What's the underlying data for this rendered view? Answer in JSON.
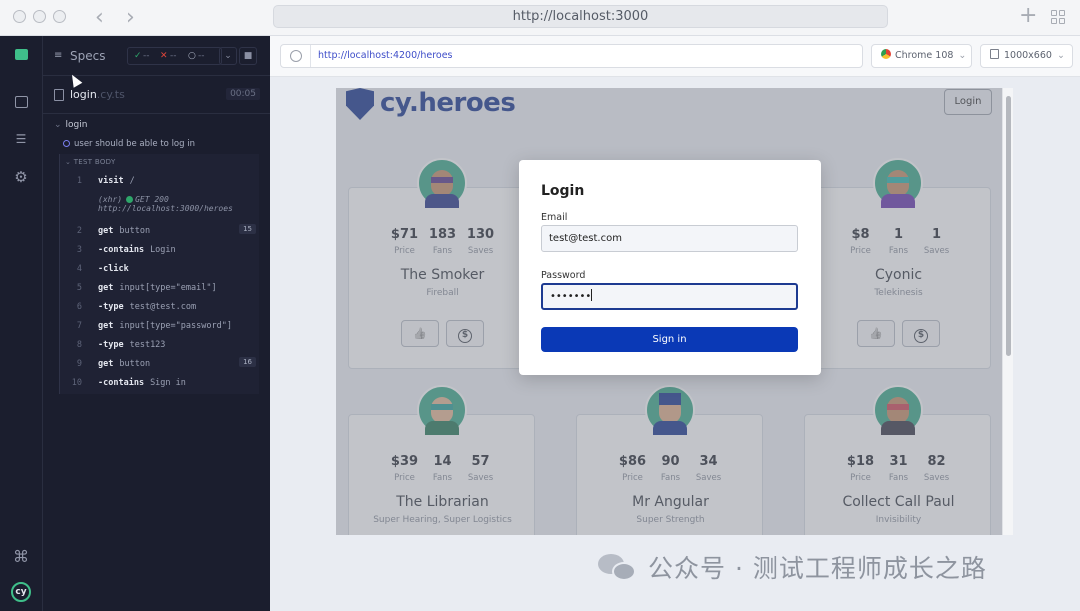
{
  "window": {
    "url": "http://localhost:3000"
  },
  "icons": {
    "back": "‹",
    "forward": "›",
    "plus": "+",
    "check": "✓",
    "cross": "✕",
    "pending": "○",
    "chevron": "⌄",
    "stop": "■",
    "rail_debug": "⌘",
    "like": "👍",
    "dollar": "$"
  },
  "reporter": {
    "specs_label": "Specs",
    "passed": "--",
    "failed": "--",
    "pending": "--",
    "file_name": "login",
    "file_ext": ".cy.ts",
    "duration": "00:05",
    "suite": "login",
    "test_title": "user should be able to log in",
    "test_body_label": "TEST BODY",
    "commands": [
      {
        "num": "1",
        "name": "visit",
        "arg": "/"
      },
      {
        "num": "2",
        "name": "get",
        "arg": "button",
        "badge": "15"
      },
      {
        "num": "3",
        "name": "-contains",
        "arg": "Login"
      },
      {
        "num": "4",
        "name": "-click",
        "arg": ""
      },
      {
        "num": "5",
        "name": "get",
        "arg": "input[type=\"email\"]"
      },
      {
        "num": "6",
        "name": "-type",
        "arg": "test@test.com"
      },
      {
        "num": "7",
        "name": "get",
        "arg": "input[type=\"password\"]"
      },
      {
        "num": "8",
        "name": "-type",
        "arg": "test123"
      },
      {
        "num": "9",
        "name": "get",
        "arg": "button",
        "badge": "16"
      },
      {
        "num": "10",
        "name": "-contains",
        "arg": "Sign in"
      }
    ],
    "xhr": {
      "label": "(xhr)",
      "status": "GET 200",
      "url": "http://localhost:3000/heroes"
    }
  },
  "browser_toolbar": {
    "url": "http://localhost:4200/heroes",
    "browser": "Chrome 108",
    "viewport": "1000x660"
  },
  "app": {
    "logo_text": "cy.heroes",
    "login_button": "Login",
    "stat_labels": {
      "price": "Price",
      "fans": "Fans",
      "saves": "Saves"
    },
    "heroes": [
      {
        "name": "The Smoker",
        "power": "Fireball",
        "price": "$71",
        "fans": "183",
        "saves": "130"
      },
      {
        "name": "Cyonic",
        "power": "Telekinesis",
        "price": "$8",
        "fans": "1",
        "saves": "1"
      },
      {
        "name": "The Librarian",
        "power": "Super Hearing,  Super Logistics",
        "price": "$39",
        "fans": "14",
        "saves": "57"
      },
      {
        "name": "Mr Angular",
        "power": "Super Strength",
        "price": "$86",
        "fans": "90",
        "saves": "34"
      },
      {
        "name": "Collect Call Paul",
        "power": "Invisibility",
        "price": "$18",
        "fans": "31",
        "saves": "82"
      }
    ]
  },
  "modal": {
    "title": "Login",
    "email_label": "Email",
    "email_value": "test@test.com",
    "password_label": "Password",
    "password_value": "•••••••",
    "submit": "Sign in"
  },
  "watermark": "公众号 · 测试工程师成长之路",
  "colors": {
    "accent": "#0a39b6",
    "brand": "#1d3a91",
    "sidebar": "#1b1e2e",
    "pass": "#2ea66a",
    "fail": "#e0453a"
  }
}
